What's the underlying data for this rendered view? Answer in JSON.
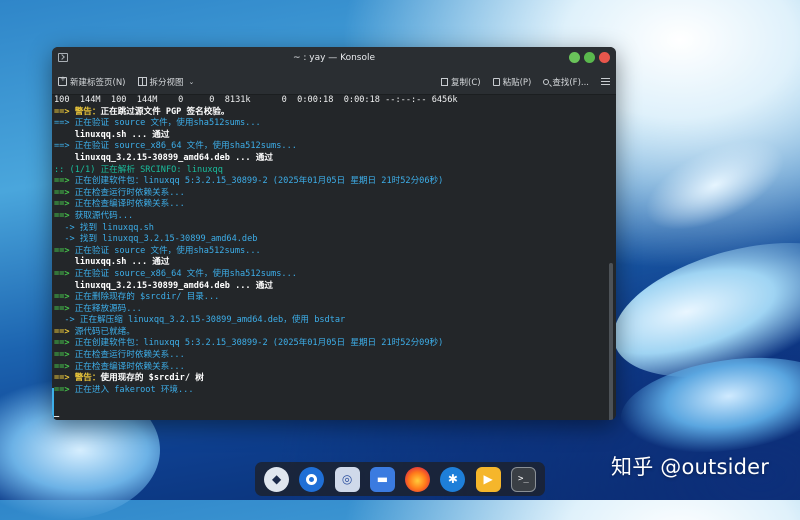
{
  "window": {
    "title": "~ : yay — Konsole",
    "colors": {
      "background": "#232629",
      "arrow": "#46c34a",
      "warning": "#e9c53a",
      "path": "#3daee9"
    }
  },
  "toolbar": {
    "new_tab": "新建标签页(N)",
    "split_view": "拆分视图",
    "copy": "复制(C)",
    "paste": "粘贴(P)",
    "find": "查找(F)..."
  },
  "terminal": {
    "lines": [
      [
        {
          "t": "100  144M  100  144M    0     0  8131k      0  0:00:18  0:00:18 --:--:-- 6456k",
          "c": ""
        }
      ],
      [
        {
          "t": "==> ",
          "c": "c-warn"
        },
        {
          "t": "警告：",
          "c": "c-warn"
        },
        {
          "t": "正在跳过源文件 PGP 签名校验。",
          "c": "c-white"
        }
      ],
      [
        {
          "t": "==> ",
          "c": "c-blue"
        },
        {
          "t": "正在验证 source 文件，使用sha512sums...",
          "c": "c-blue"
        }
      ],
      [
        {
          "t": "    linuxqq.sh ... 通过",
          "c": "c-white"
        }
      ],
      [
        {
          "t": "==> ",
          "c": "c-blue"
        },
        {
          "t": "正在验证 source_x86_64 文件，使用sha512sums...",
          "c": "c-blue"
        }
      ],
      [
        {
          "t": "    linuxqq_3.2.15-30899_amd64.deb ... 通过",
          "c": "c-white"
        }
      ],
      [
        {
          "t": ":: (1/1) 正在解析 SRCINFO: linuxqq",
          "c": "c-info"
        }
      ],
      [
        {
          "t": "==> ",
          "c": "c-arrow"
        },
        {
          "t": "正在创建软件包：linuxqq 5:3.2.15_30899-2 (2025年01月05日 星期日 21时52分06秒)",
          "c": "c-blue"
        }
      ],
      [
        {
          "t": "==> ",
          "c": "c-arrow"
        },
        {
          "t": "正在检查运行时依赖关系...",
          "c": "c-blue"
        }
      ],
      [
        {
          "t": "==> ",
          "c": "c-arrow"
        },
        {
          "t": "正在检查编译时依赖关系...",
          "c": "c-blue"
        }
      ],
      [
        {
          "t": "==> ",
          "c": "c-arrow"
        },
        {
          "t": "获取源代码...",
          "c": "c-blue"
        }
      ],
      [
        {
          "t": "  -> ",
          "c": "c-blue"
        },
        {
          "t": "找到 linuxqq.sh",
          "c": "c-blue"
        }
      ],
      [
        {
          "t": "  -> ",
          "c": "c-blue"
        },
        {
          "t": "找到 linuxqq_3.2.15-30899_amd64.deb",
          "c": "c-blue"
        }
      ],
      [
        {
          "t": "==> ",
          "c": "c-arrow"
        },
        {
          "t": "正在验证 source 文件，使用sha512sums...",
          "c": "c-blue"
        }
      ],
      [
        {
          "t": "    linuxqq.sh ... 通过",
          "c": "c-white"
        }
      ],
      [
        {
          "t": "==> ",
          "c": "c-arrow"
        },
        {
          "t": "正在验证 source_x86_64 文件，使用sha512sums...",
          "c": "c-blue"
        }
      ],
      [
        {
          "t": "    linuxqq_3.2.15-30899_amd64.deb ... 通过",
          "c": "c-white"
        }
      ],
      [
        {
          "t": "==> ",
          "c": "c-arrow"
        },
        {
          "t": "正在删除现存的 $srcdir/ 目录...",
          "c": "c-blue"
        }
      ],
      [
        {
          "t": "==> ",
          "c": "c-arrow"
        },
        {
          "t": "正在释放源码...",
          "c": "c-blue"
        }
      ],
      [
        {
          "t": "  -> ",
          "c": "c-blue"
        },
        {
          "t": "正在解压缩 linuxqq_3.2.15-30899_amd64.deb，使用 bsdtar",
          "c": "c-blue"
        }
      ],
      [
        {
          "t": "==> ",
          "c": "c-warn"
        },
        {
          "t": "源代码已就绪。",
          "c": "c-blue"
        }
      ],
      [
        {
          "t": "==> ",
          "c": "c-arrow"
        },
        {
          "t": "正在创建软件包：linuxqq 5:3.2.15_30899-2 (2025年01月05日 星期日 21时52分09秒)",
          "c": "c-blue"
        }
      ],
      [
        {
          "t": "==> ",
          "c": "c-arrow"
        },
        {
          "t": "正在检查运行时依赖关系...",
          "c": "c-blue"
        }
      ],
      [
        {
          "t": "==> ",
          "c": "c-arrow"
        },
        {
          "t": "正在检查编译时依赖关系...",
          "c": "c-blue"
        }
      ],
      [
        {
          "t": "==> ",
          "c": "c-warn"
        },
        {
          "t": "警告：",
          "c": "c-warn"
        },
        {
          "t": "使用现存的 $srcdir/ 树",
          "c": "c-white"
        }
      ],
      [
        {
          "t": "==> ",
          "c": "c-arrow"
        },
        {
          "t": "正在进入 fakeroot 环境...",
          "c": "c-blue"
        }
      ],
      [
        {
          "t": "",
          "c": ""
        }
      ],
      [
        {
          "t": "_",
          "c": "c-white"
        }
      ]
    ]
  },
  "dock": {
    "icons": [
      "desktop-icon",
      "toggle-icon",
      "store-icon",
      "folder-icon",
      "firefox-icon",
      "app-icon",
      "media-player-icon",
      "terminal-icon"
    ],
    "terminal_glyph": ">_"
  },
  "watermark": "知乎 @outsider"
}
